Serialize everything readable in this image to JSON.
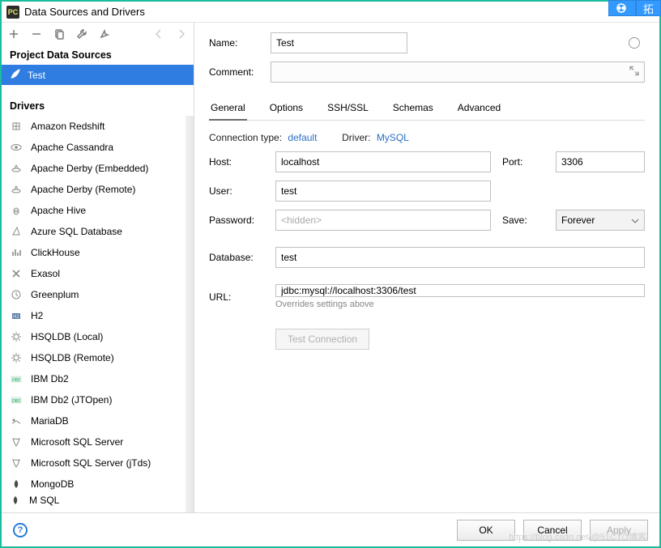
{
  "window": {
    "title": "Data Sources and Drivers"
  },
  "ext": {
    "label": "拓"
  },
  "sidebar": {
    "project_head": "Project Data Sources",
    "selected_ds": "Test",
    "drivers_head": "Drivers",
    "drivers": [
      {
        "name": "Amazon Redshift",
        "icon": "redshift"
      },
      {
        "name": "Apache Cassandra",
        "icon": "eye"
      },
      {
        "name": "Apache Derby (Embedded)",
        "icon": "hat"
      },
      {
        "name": "Apache Derby (Remote)",
        "icon": "hat"
      },
      {
        "name": "Apache Hive",
        "icon": "bee"
      },
      {
        "name": "Azure SQL Database",
        "icon": "azure"
      },
      {
        "name": "ClickHouse",
        "icon": "bars"
      },
      {
        "name": "Exasol",
        "icon": "x"
      },
      {
        "name": "Greenplum",
        "icon": "clock"
      },
      {
        "name": "H2",
        "icon": "h2"
      },
      {
        "name": "HSQLDB (Local)",
        "icon": "gear"
      },
      {
        "name": "HSQLDB (Remote)",
        "icon": "gear"
      },
      {
        "name": "IBM Db2",
        "icon": "db2"
      },
      {
        "name": "IBM Db2 (JTOpen)",
        "icon": "db2"
      },
      {
        "name": "MariaDB",
        "icon": "seal"
      },
      {
        "name": "Microsoft SQL Server",
        "icon": "mssql"
      },
      {
        "name": "Microsoft SQL Server (jTds)",
        "icon": "mssql"
      },
      {
        "name": "MongoDB",
        "icon": "leaf"
      }
    ],
    "cutoff_label": "MySQL"
  },
  "form": {
    "name_label": "Name:",
    "name_value": "Test",
    "comment_label": "Comment:",
    "tabs": [
      "General",
      "Options",
      "SSH/SSL",
      "Schemas",
      "Advanced"
    ],
    "active_tab": 0,
    "conn_type_label": "Connection type:",
    "conn_type_value": "default",
    "driver_label": "Driver:",
    "driver_value": "MySQL",
    "host_label": "Host:",
    "host_value": "localhost",
    "port_label": "Port:",
    "port_value": "3306",
    "user_label": "User:",
    "user_value": "test",
    "password_label": "Password:",
    "password_placeholder": "<hidden>",
    "save_label": "Save:",
    "save_value": "Forever",
    "database_label": "Database:",
    "database_value": "test",
    "url_label": "URL:",
    "url_value": "jdbc:mysql://localhost:3306/test",
    "url_hint": "Overrides settings above",
    "test_btn": "Test Connection"
  },
  "footer": {
    "ok": "OK",
    "cancel": "Cancel",
    "apply": "Apply"
  },
  "watermark": "https://blog.csdn.net/@51CTO博客"
}
